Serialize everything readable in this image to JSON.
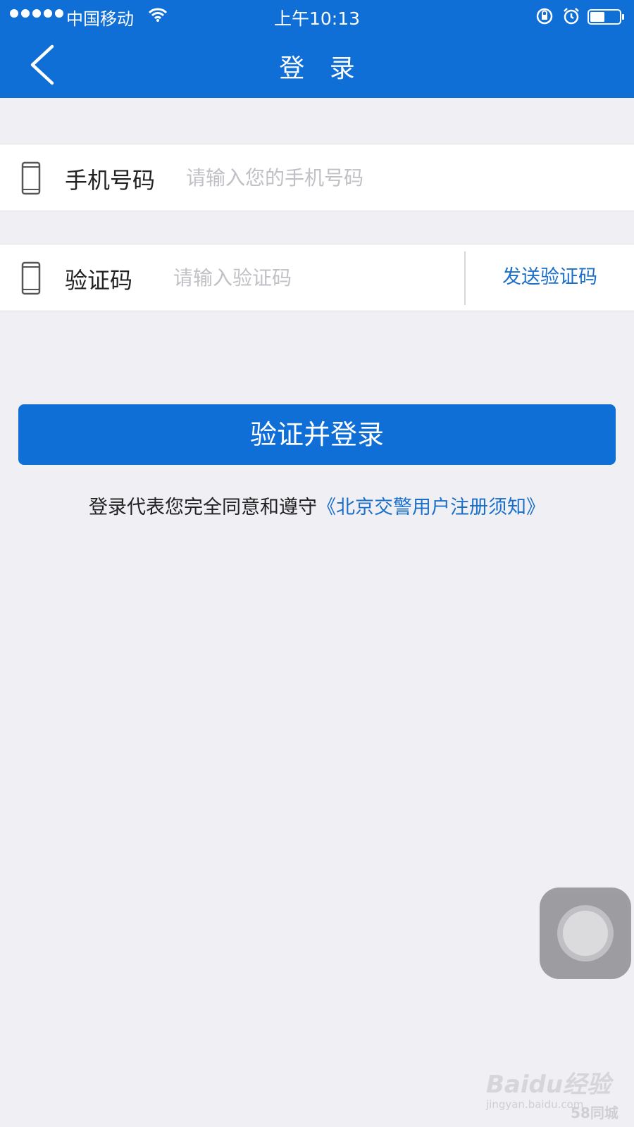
{
  "status_bar": {
    "carrier": "中国移动",
    "time": "上午10:13",
    "signal_dots": 5
  },
  "nav": {
    "title": "登 录"
  },
  "form": {
    "phone": {
      "label": "手机号码",
      "placeholder": "请输入您的手机号码"
    },
    "code": {
      "label": "验证码",
      "placeholder": "请输入验证码",
      "send_label": "发送验证码"
    }
  },
  "login_button": "验证并登录",
  "agreement": {
    "text": "登录代表您完全同意和遵守",
    "link": "《北京交警用户注册须知》"
  },
  "watermark": {
    "brand": "Baidu经验",
    "url": "jingyan.baidu.com",
    "partner": "58同城"
  },
  "colors": {
    "primary": "#106fd6",
    "link": "#1a6fcb",
    "background": "#efeff4"
  }
}
